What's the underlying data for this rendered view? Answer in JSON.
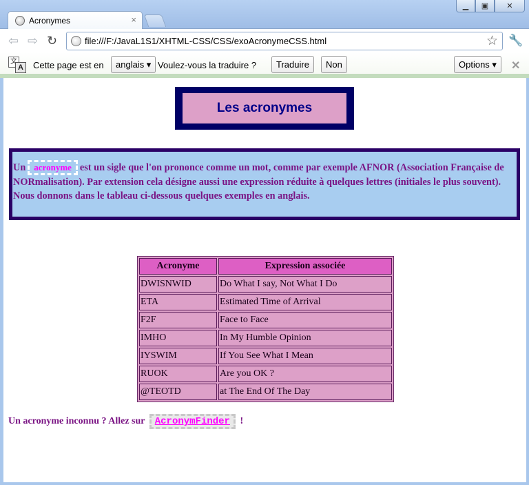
{
  "browser": {
    "tab_title": "Acronymes",
    "tab_close": "×",
    "url": "file:///F:/JavaL1S1/XHTML-CSS/CSS/exoAcronymeCSS.html",
    "window_buttons": {
      "minimize": "▁",
      "maximize": "▣",
      "close": "✕"
    }
  },
  "infobar": {
    "text_before": "Cette page est en",
    "language": "anglais ▾",
    "text_question": "Voulez-vous la traduire ?",
    "translate_button": "Traduire",
    "no_button": "Non",
    "options_button": "Options ▾",
    "close": "✕"
  },
  "page": {
    "title": "Les acronymes",
    "intro": {
      "prefix": "Un",
      "term": "acronyme",
      "rest": "est un sigle que l'on prononce comme un mot, comme par exemple AFNOR (Association Française de NORmalisation). Par extension cela désigne aussi une expression réduite à quelques lettres (initiales le plus souvent). Nous donnons dans le tableau ci-dessous quelques exemples en anglais."
    },
    "table": {
      "headers": [
        "Acronyme",
        "Expression associée"
      ],
      "rows": [
        [
          "DWISNWID",
          "Do What I say, Not What I Do"
        ],
        [
          "ETA",
          "Estimated Time of Arrival"
        ],
        [
          "F2F",
          "Face to Face"
        ],
        [
          "IMHO",
          "In My Humble Opinion"
        ],
        [
          "IYSWIM",
          "If You See What I Mean"
        ],
        [
          "RUOK",
          "Are you OK ?"
        ],
        [
          "@TEOTD",
          "at The End Of The Day"
        ]
      ]
    },
    "footer": {
      "prefix": "Un acronyme inconnu ? Allez sur",
      "link_text": "AcronymFinder",
      "suffix": "!"
    }
  },
  "colors": {
    "title_frame": "#000066",
    "title_bg": "#dda0c8",
    "intro_bg": "#a8cdf0",
    "text_purple": "#7a1484",
    "header_cell": "#dd5fc4",
    "body_cell": "#dda0c8",
    "link_magenta": "#ff00ff"
  }
}
